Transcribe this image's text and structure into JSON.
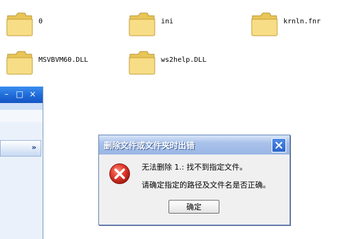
{
  "folders": [
    {
      "name": "0",
      "icon": "folder-icon"
    },
    {
      "name": "ini",
      "icon": "folder-icon"
    },
    {
      "name": "krnln.fnr",
      "icon": "folder-icon"
    },
    {
      "name": "MSVBVM60.DLL",
      "icon": "folder-icon"
    },
    {
      "name": "ws2help.DLL",
      "icon": "folder-icon"
    }
  ],
  "left_window": {
    "controls": {
      "minimize": "–",
      "maximize": "□",
      "close": "×"
    },
    "panel_chevron": "»"
  },
  "dialog": {
    "title": "删除文件或文件夹时出错",
    "message_line1": "无法删除 1.: 找不到指定文件。",
    "message_line2": "请确定指定的路径及文件名是否正确。",
    "ok_label": "确定",
    "icon": "error-icon"
  },
  "colors": {
    "folder_yellow": "#f3d36a",
    "xp_blue": "#1f6ad8",
    "error_red": "#d42a2a",
    "dialog_bg": "#f0f0f0"
  }
}
